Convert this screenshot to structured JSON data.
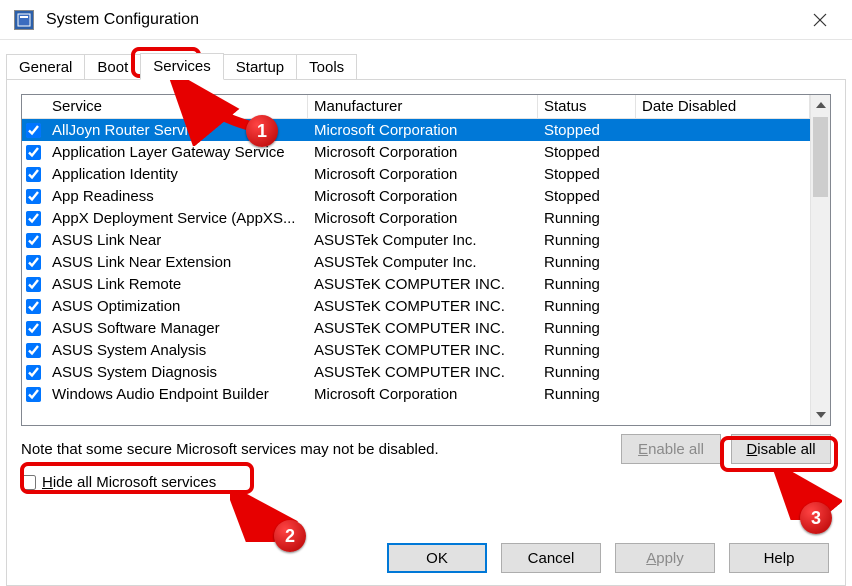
{
  "window": {
    "title": "System Configuration"
  },
  "tabs": [
    {
      "label": "General"
    },
    {
      "label": "Boot"
    },
    {
      "label": "Services",
      "active": true
    },
    {
      "label": "Startup"
    },
    {
      "label": "Tools"
    }
  ],
  "columns": {
    "service": "Service",
    "manufacturer": "Manufacturer",
    "status": "Status",
    "date_disabled": "Date Disabled"
  },
  "rows": [
    {
      "checked": true,
      "service": "AllJoyn Router Service",
      "manufacturer": "Microsoft Corporation",
      "status": "Stopped",
      "selected": true
    },
    {
      "checked": true,
      "service": "Application Layer Gateway Service",
      "manufacturer": "Microsoft Corporation",
      "status": "Stopped"
    },
    {
      "checked": true,
      "service": "Application Identity",
      "manufacturer": "Microsoft Corporation",
      "status": "Stopped"
    },
    {
      "checked": true,
      "service": "App Readiness",
      "manufacturer": "Microsoft Corporation",
      "status": "Stopped"
    },
    {
      "checked": true,
      "service": "AppX Deployment Service (AppXS...",
      "manufacturer": "Microsoft Corporation",
      "status": "Running"
    },
    {
      "checked": true,
      "service": "ASUS Link Near",
      "manufacturer": "ASUSTek Computer Inc.",
      "status": "Running"
    },
    {
      "checked": true,
      "service": "ASUS Link Near Extension",
      "manufacturer": "ASUSTek Computer Inc.",
      "status": "Running"
    },
    {
      "checked": true,
      "service": "ASUS Link Remote",
      "manufacturer": "ASUSTeK COMPUTER INC.",
      "status": "Running"
    },
    {
      "checked": true,
      "service": "ASUS Optimization",
      "manufacturer": "ASUSTeK COMPUTER INC.",
      "status": "Running"
    },
    {
      "checked": true,
      "service": "ASUS Software Manager",
      "manufacturer": "ASUSTeK COMPUTER INC.",
      "status": "Running"
    },
    {
      "checked": true,
      "service": "ASUS System Analysis",
      "manufacturer": "ASUSTeK COMPUTER INC.",
      "status": "Running"
    },
    {
      "checked": true,
      "service": "ASUS System Diagnosis",
      "manufacturer": "ASUSTeK COMPUTER INC.",
      "status": "Running"
    },
    {
      "checked": true,
      "service": "Windows Audio Endpoint Builder",
      "manufacturer": "Microsoft Corporation",
      "status": "Running"
    }
  ],
  "note": "Note that some secure Microsoft services may not be disabled.",
  "hide_pre": "H",
  "hide_rest": "ide all Microsoft services",
  "buttons": {
    "enable_pre": "E",
    "enable_rest": "nable all",
    "disable_pre": "D",
    "disable_rest": "isable all",
    "ok": "OK",
    "cancel": "Cancel",
    "apply_pre": "A",
    "apply_rest": "pply",
    "help": "Help"
  },
  "annotations": {
    "n1": "1",
    "n2": "2",
    "n3": "3"
  }
}
